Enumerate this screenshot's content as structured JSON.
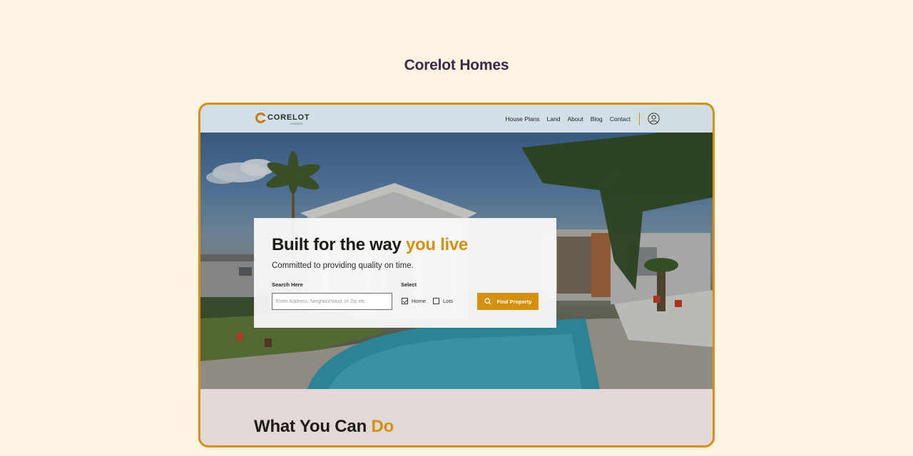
{
  "page": {
    "title": "Corelot Homes"
  },
  "brand": {
    "name": "CORELOT",
    "sub": "HOMES",
    "accent_color": "#d4900f"
  },
  "nav": {
    "links": [
      "House Plans",
      "Land",
      "About",
      "Blog",
      "Contact"
    ],
    "user_icon": "user-icon"
  },
  "hero": {
    "headline_main": "Built for the way ",
    "headline_accent": "you live",
    "subline": "Committed to providing quality on time.",
    "search": {
      "label": "Search Here",
      "placeholder": "Enter Address, Neighborhood, or Zip etc",
      "value": ""
    },
    "select": {
      "label": "Select",
      "options": [
        {
          "label": "Home",
          "checked": true
        },
        {
          "label": "Lots",
          "checked": false
        }
      ]
    },
    "find_button": "Find Property",
    "find_icon": "search-icon"
  },
  "section": {
    "title_main": "What You Can ",
    "title_accent": "Do"
  }
}
